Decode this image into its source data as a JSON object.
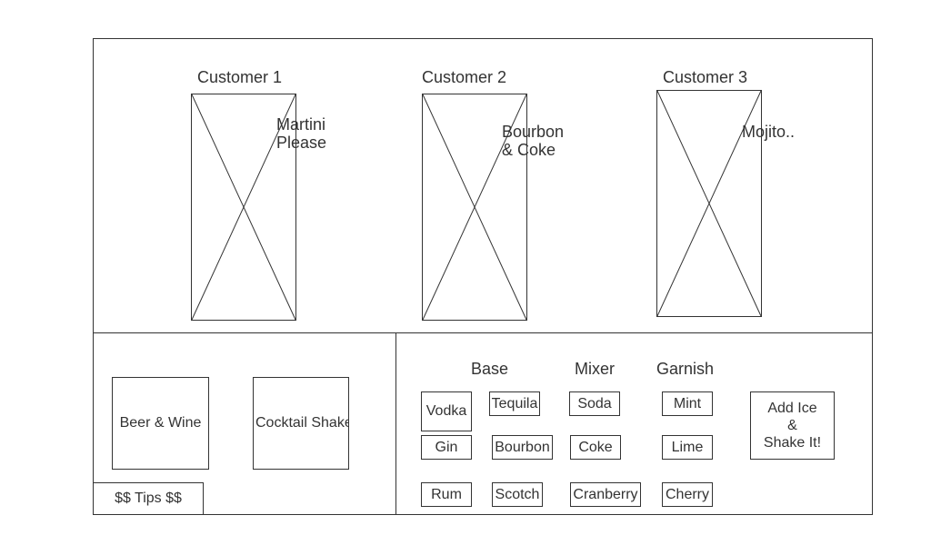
{
  "customers": [
    {
      "label": "Customer 1",
      "order": "Martini\nPlease"
    },
    {
      "label": "Customer 2",
      "order": "Bourbon\n& Coke"
    },
    {
      "label": "Customer 3",
      "order": "Mojito.."
    }
  ],
  "left_panel": {
    "beer_wine": "Beer & Wine",
    "cocktail_shaker": "Cocktail Shaker",
    "tips": "$$ Tips $$"
  },
  "ingredients": {
    "base": {
      "heading": "Base",
      "items": [
        "Vodka",
        "Gin",
        "Rum"
      ]
    },
    "base2": {
      "items": [
        "Tequila",
        "Bourbon",
        "Scotch"
      ]
    },
    "mixer": {
      "heading": "Mixer",
      "items": [
        "Soda",
        "Coke",
        "Cranberry"
      ]
    },
    "garnish": {
      "heading": "Garnish",
      "items": [
        "Mint",
        "Lime",
        "Cherry"
      ]
    }
  },
  "shake_button": "Add Ice\n&\nShake It!"
}
